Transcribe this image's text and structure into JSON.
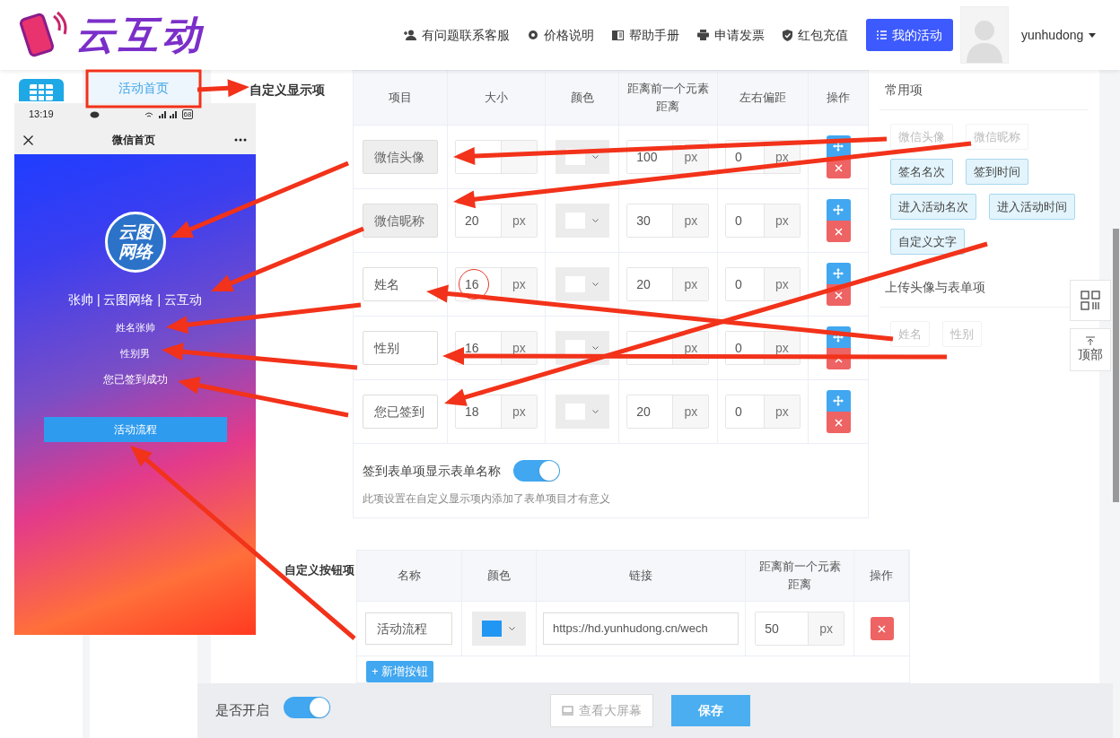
{
  "header": {
    "logo_text": "云互动",
    "nav": [
      {
        "label": "有问题联系客服"
      },
      {
        "label": "价格说明"
      },
      {
        "label": "帮助手册"
      },
      {
        "label": "申请发票"
      },
      {
        "label": "红包充值"
      }
    ],
    "primary_button": "我的活动",
    "username": "yunhudong"
  },
  "sidebar": {
    "items": [
      {
        "label": "活动首页",
        "selected": true
      }
    ]
  },
  "display_section": {
    "title": "自定义显示项",
    "columns": [
      "项目",
      "大小",
      "颜色",
      "距离前一个元素距离",
      "左右偏距",
      "操作"
    ],
    "rows": [
      {
        "item": "微信头像",
        "disabled": true,
        "size": {},
        "color": "#ffffff",
        "distance": {
          "value": "100",
          "unit": "px"
        },
        "offset": {
          "value": "0",
          "unit": "px"
        }
      },
      {
        "item": "微信昵称",
        "disabled": true,
        "size": {
          "value": "20",
          "unit": "px"
        },
        "color": "#ffffff",
        "distance": {
          "value": "30",
          "unit": "px"
        },
        "offset": {
          "value": "0",
          "unit": "px"
        }
      },
      {
        "item": "姓名",
        "disabled": false,
        "size": {
          "value": "16",
          "unit": "px"
        },
        "color": "#ffffff",
        "distance": {
          "value": "20",
          "unit": "px"
        },
        "offset": {
          "value": "0",
          "unit": "px"
        }
      },
      {
        "item": "性别",
        "disabled": false,
        "size": {
          "value": "16",
          "unit": "px"
        },
        "color": "#ffffff",
        "distance": {
          "unit": "px"
        },
        "offset": {
          "value": "0",
          "unit": "px"
        }
      },
      {
        "item": "您已签到",
        "disabled": false,
        "size": {
          "value": "18",
          "unit": "px"
        },
        "color": "#ffffff",
        "distance": {
          "value": "20",
          "unit": "px"
        },
        "offset": {
          "value": "0",
          "unit": "px"
        }
      }
    ],
    "toggle": {
      "label": "签到表单项显示表单名称",
      "on": true,
      "note": "此项设置在自定义显示项内添加了表单项目才有意义"
    }
  },
  "right_panel": {
    "groups": [
      {
        "title": "常用项",
        "tags": [
          {
            "label": "微信头像",
            "disabled": true
          },
          {
            "label": "微信昵称",
            "disabled": true
          },
          {
            "label": "签名名次",
            "disabled": false
          },
          {
            "label": "签到时间",
            "disabled": false
          },
          {
            "label": "进入活动名次",
            "disabled": false
          },
          {
            "label": "进入活动时间",
            "disabled": false
          },
          {
            "label": "自定义文字",
            "disabled": false
          }
        ]
      },
      {
        "title": "上传头像与表单项",
        "tags": [
          {
            "label": "姓名",
            "disabled": true
          },
          {
            "label": "性别",
            "disabled": true
          }
        ]
      }
    ]
  },
  "float_buttons": {
    "top_label": "顶部"
  },
  "button_section": {
    "title": "自定义按钮项",
    "columns": [
      "名称",
      "颜色",
      "链接",
      "距离前一个元素距离",
      "操作"
    ],
    "rows": [
      {
        "name": "活动流程",
        "color": "#2196f3",
        "link": "https://hd.yunhudong.cn/wech",
        "distance": {
          "value": "50",
          "unit": "px"
        }
      }
    ],
    "add_button": "+ 新增按钮"
  },
  "footer": {
    "label": "是否开启",
    "on": true,
    "buttons": [
      {
        "label": "查看大屏幕",
        "kind": "secondary"
      },
      {
        "label": "保存",
        "kind": "primary"
      }
    ]
  },
  "phone": {
    "time": "13:19",
    "battery": "68",
    "title": "微信首页",
    "logo_lines": [
      "云图",
      "网络"
    ],
    "lines": [
      "张帅 | 云图网络 | 云互动",
      "姓名张帅",
      "性别男",
      "您已签到成功"
    ],
    "button": "活动流程"
  }
}
